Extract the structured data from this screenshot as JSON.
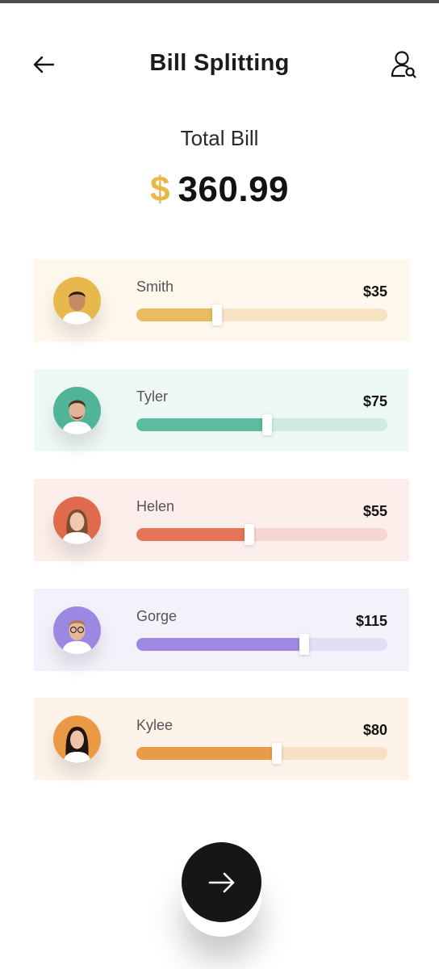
{
  "header": {
    "title": "Bill Splitting",
    "back_icon": "arrow-left-icon",
    "profile_icon": "user-search-icon"
  },
  "total": {
    "label": "Total Bill",
    "currency": "$",
    "amount": "360.99",
    "currency_color": "#e9b848"
  },
  "people": [
    {
      "name": "Smith",
      "amount": "$35",
      "share": 0.32,
      "bg": "#fdf7ec",
      "track": "#f7e3c4",
      "fill": "#e9bd5f",
      "avatar_bg": "#e7b84e"
    },
    {
      "name": "Tyler",
      "amount": "$75",
      "share": 0.52,
      "bg": "#eef8f5",
      "track": "#cdebe2",
      "fill": "#5dbb9f",
      "avatar_bg": "#4fb498"
    },
    {
      "name": "Helen",
      "amount": "$55",
      "share": 0.45,
      "bg": "#fcefeb",
      "track": "#f6d6cf",
      "fill": "#e57457",
      "avatar_bg": "#e06a4d"
    },
    {
      "name": "Gorge",
      "amount": "$115",
      "share": 0.67,
      "bg": "#f3f2fb",
      "track": "#e2def6",
      "fill": "#9d8ae0",
      "avatar_bg": "#9b88e2"
    },
    {
      "name": "Kylee",
      "amount": "$80",
      "share": 0.56,
      "bg": "#fdf3e9",
      "track": "#f7e0c6",
      "fill": "#ea9b48",
      "avatar_bg": "#ea9a45"
    }
  ],
  "next_button": {
    "icon": "arrow-right-icon"
  }
}
